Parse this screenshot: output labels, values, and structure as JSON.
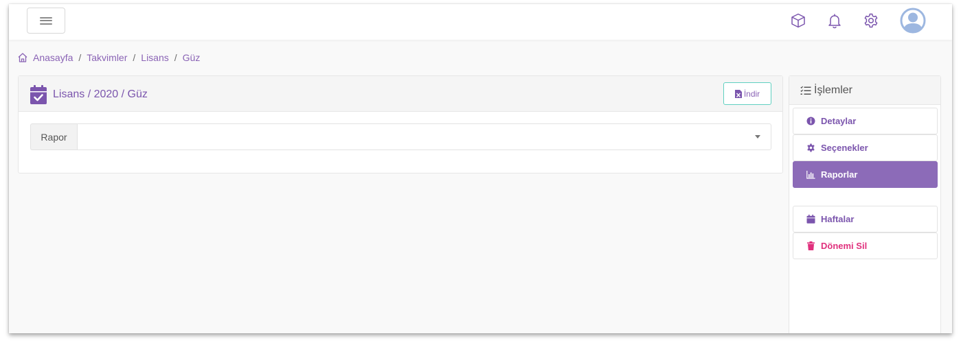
{
  "topbar": {
    "menu_icon": "hamburger-menu-icon",
    "icons": [
      "cube-icon",
      "bell-icon",
      "gear-icon",
      "user-avatar-icon"
    ]
  },
  "breadcrumb": {
    "home_icon": "home-icon",
    "items": [
      "Anasayfa",
      "Takvimler",
      "Lisans",
      "Güz"
    ]
  },
  "card": {
    "title_icon": "calendar-check-icon",
    "title": "Lisans / 2020 / Güz",
    "download_icon": "excel-file-icon",
    "download_label": "İndir",
    "report_label": "Rapor",
    "report_value": ""
  },
  "side": {
    "header_icon": "tasks-icon",
    "title": "İşlemler",
    "items": [
      {
        "label": "Detaylar",
        "icon": "info-circle-icon"
      },
      {
        "label": "Seçenekler",
        "icon": "cog-icon"
      },
      {
        "label": "Raporlar",
        "icon": "bar-chart-icon",
        "active": true
      },
      {
        "label": "Haftalar",
        "icon": "calendar-icon"
      },
      {
        "label": "Dönemi Sil",
        "icon": "trash-icon",
        "danger": true
      }
    ]
  },
  "colors": {
    "accent": "#8c6bb8",
    "link": "#8a63b5",
    "danger": "#e0307d",
    "teal_border": "#5fd0c0",
    "avatar": "#9db7e0"
  }
}
